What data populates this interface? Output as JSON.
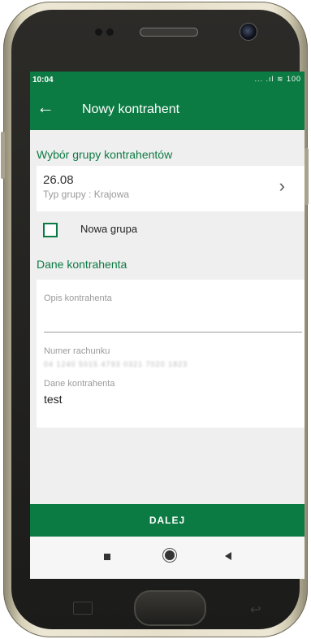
{
  "status_bar": {
    "time": "10:04",
    "icons": "... .ıl ≋ 100"
  },
  "app_bar": {
    "back_icon": "←",
    "title": "Nowy kontrahent"
  },
  "group_section": {
    "title": "Wybór grupy kontrahentów",
    "selected_group": {
      "name": "26.08",
      "type": "Typ grupy : Krajowa",
      "chevron": "›"
    },
    "new_group_checkbox": {
      "label": "Nowa grupa",
      "checked": false
    }
  },
  "contractor_section": {
    "title": "Dane kontrahenta",
    "description_field": {
      "placeholder": "Opis kontrahenta",
      "value": ""
    },
    "account_field": {
      "label": "Numer rachunku",
      "value": "04 1240 5015 4793 0321 7020 1823"
    },
    "contractor_data_field": {
      "label": "Dane kontrahenta",
      "value": "test"
    }
  },
  "buttons": {
    "next": "DALEJ"
  },
  "colors": {
    "brand_green": "#0c7a43",
    "background": "#efefef"
  }
}
